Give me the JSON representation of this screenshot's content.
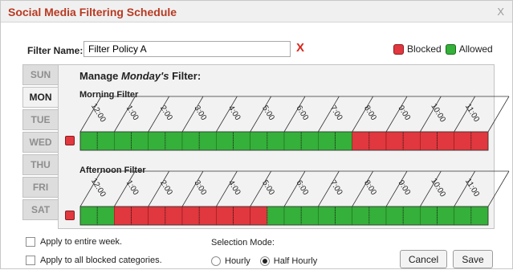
{
  "title": "Social Media Filtering Schedule",
  "close_label": "X",
  "filter": {
    "label": "Filter Name:",
    "value": "Filter Policy A",
    "clear_label": "X"
  },
  "legend": {
    "blocked": "Blocked",
    "allowed": "Allowed"
  },
  "colors": {
    "blocked": "#e0383e",
    "allowed": "#35b03a",
    "title": "#b83a22",
    "clear": "#d8261d"
  },
  "days": [
    "SUN",
    "MON",
    "TUE",
    "WED",
    "THU",
    "FRI",
    "SAT"
  ],
  "active_day": "MON",
  "heading": {
    "prefix": "Manage ",
    "day": "Monday's",
    "suffix": " Filter:"
  },
  "hours": [
    "12:00",
    "1:00",
    "2:00",
    "3:00",
    "4:00",
    "5:00",
    "6:00",
    "7:00",
    "8:00",
    "9:00",
    "10:00",
    "11:00"
  ],
  "morning": {
    "label": "Morning Filter",
    "slots": [
      "allowed",
      "allowed",
      "allowed",
      "allowed",
      "allowed",
      "allowed",
      "allowed",
      "allowed",
      "allowed",
      "allowed",
      "allowed",
      "allowed",
      "allowed",
      "allowed",
      "allowed",
      "allowed",
      "blocked",
      "blocked",
      "blocked",
      "blocked",
      "blocked",
      "blocked",
      "blocked",
      "blocked"
    ]
  },
  "afternoon": {
    "label": "Afternoon Filter",
    "slots": [
      "allowed",
      "allowed",
      "blocked",
      "blocked",
      "blocked",
      "blocked",
      "blocked",
      "blocked",
      "blocked",
      "blocked",
      "blocked",
      "allowed",
      "allowed",
      "allowed",
      "allowed",
      "allowed",
      "allowed",
      "allowed",
      "allowed",
      "allowed",
      "allowed",
      "allowed",
      "allowed",
      "allowed"
    ]
  },
  "options": {
    "entire_week": "Apply to entire week.",
    "all_categories": "Apply to all blocked categories."
  },
  "selection_mode": {
    "label": "Selection Mode:",
    "hourly": "Hourly",
    "half_hourly": "Half Hourly",
    "selected": "half_hourly"
  },
  "buttons": {
    "cancel": "Cancel",
    "save": "Save"
  }
}
